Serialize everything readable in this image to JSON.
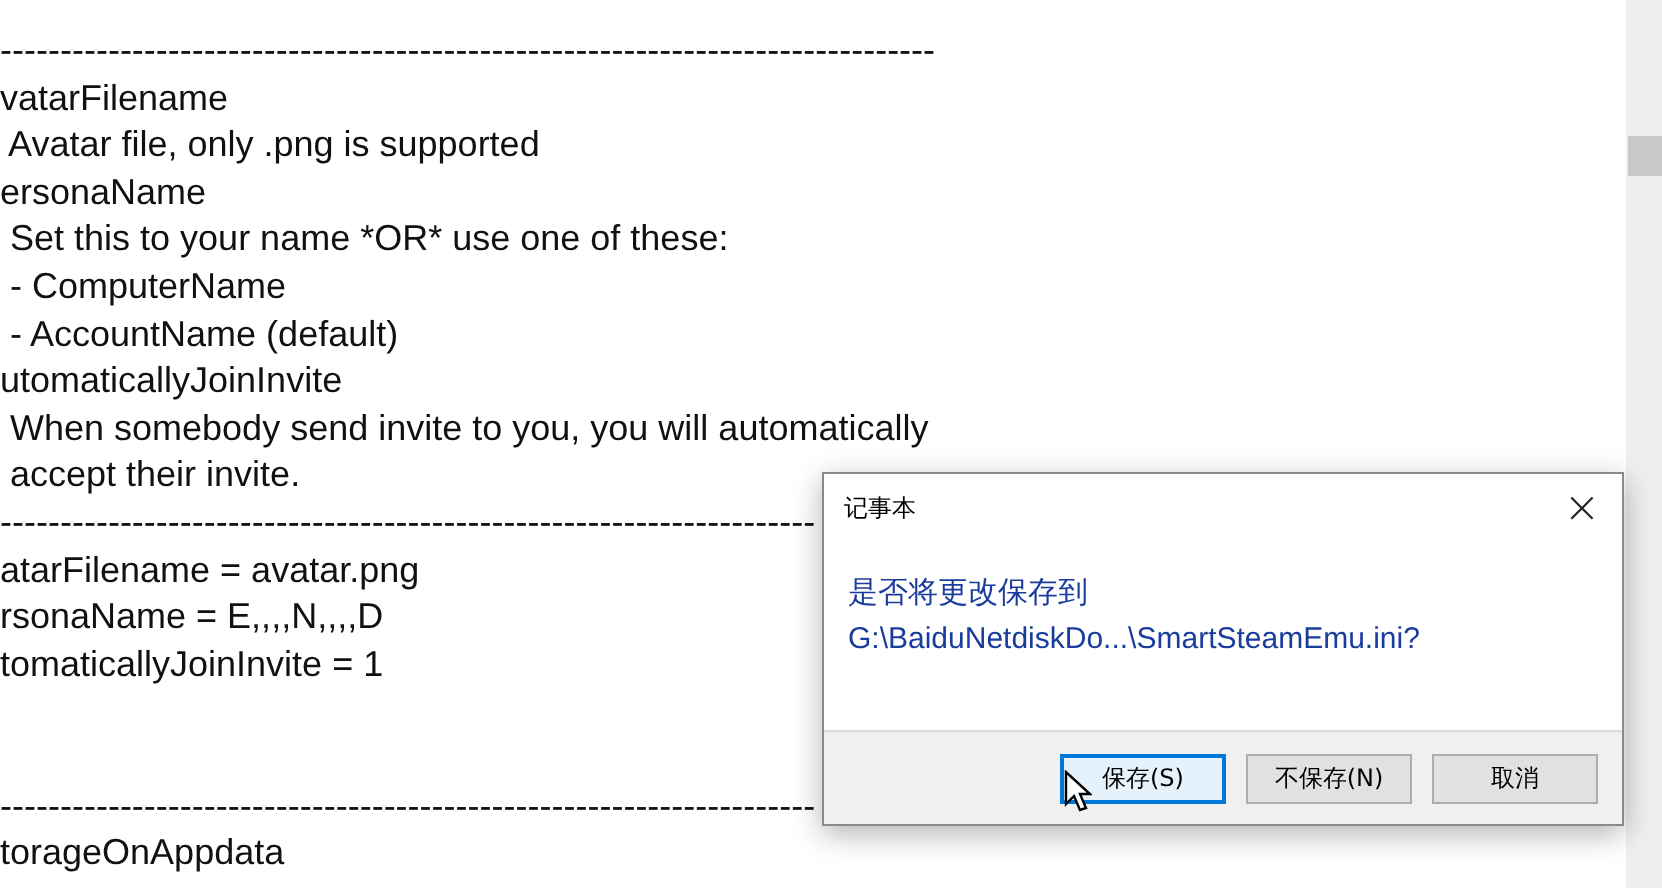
{
  "editor": {
    "lines": [
      {
        "text": "------------------------------------------------------------------------------"
      },
      {
        "text": "vatarFilename"
      },
      {
        "text": " Avatar file, only .png is supported"
      },
      {
        "text": "ersonaName"
      },
      {
        "text": " Set this to your name *OR* use one of these:"
      },
      {
        "text": " - ComputerName"
      },
      {
        "text": " - AccountName (default)"
      },
      {
        "text": "utomaticallyJoinInvite"
      },
      {
        "text": " When somebody send invite to you, you will automatically"
      },
      {
        "text": " accept their invite."
      },
      {
        "text": "--------------------------------------------------------------------"
      },
      {
        "text": "atarFilename = avatar.png"
      },
      {
        "text": "rsonaName = E,,,,N,,,,D"
      },
      {
        "text": "tomaticallyJoinInvite = 1"
      },
      {
        "kind": "blank"
      },
      {
        "kind": "blank"
      },
      {
        "text": "--------------------------------------------------------------------"
      },
      {
        "text": "torageOnAppdata"
      }
    ]
  },
  "dialog": {
    "title": "记事本",
    "close": "×",
    "message": [
      "是否将更改保存到",
      "G:\\BaiduNetdiskDo...\\SmartSteamEmu.ini?"
    ],
    "buttons": [
      {
        "label": "保存(S)",
        "selected": true
      },
      {
        "label": "不保存(N)",
        "selected": false
      },
      {
        "label": "取消",
        "selected": false
      }
    ]
  }
}
